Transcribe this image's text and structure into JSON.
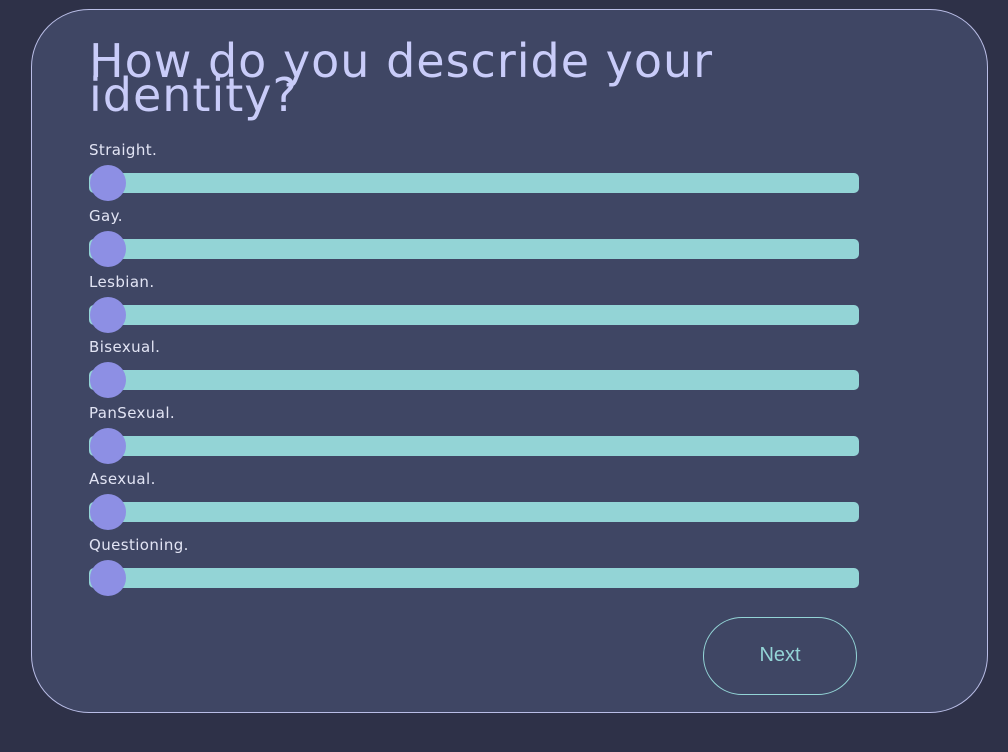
{
  "question": {
    "title": "How do you descride your identity?"
  },
  "options": [
    {
      "label": "Straight.",
      "value": 0
    },
    {
      "label": "Gay.",
      "value": 0
    },
    {
      "label": "Lesbian.",
      "value": 0
    },
    {
      "label": "Bisexual.",
      "value": 0
    },
    {
      "label": "PanSexual.",
      "value": 0
    },
    {
      "label": "Asexual.",
      "value": 0
    },
    {
      "label": "Questioning.",
      "value": 0
    }
  ],
  "actions": {
    "next_label": "Next"
  },
  "colors": {
    "page_background": "#2e3148",
    "card_background": "#3f4664",
    "card_border": "#b9bde6",
    "title_text": "#c9ccf9",
    "label_text": "#e2e4f4",
    "slider_track": "#93d4d6",
    "slider_thumb": "#8d8fe4",
    "button_accent": "#93d4d6"
  }
}
